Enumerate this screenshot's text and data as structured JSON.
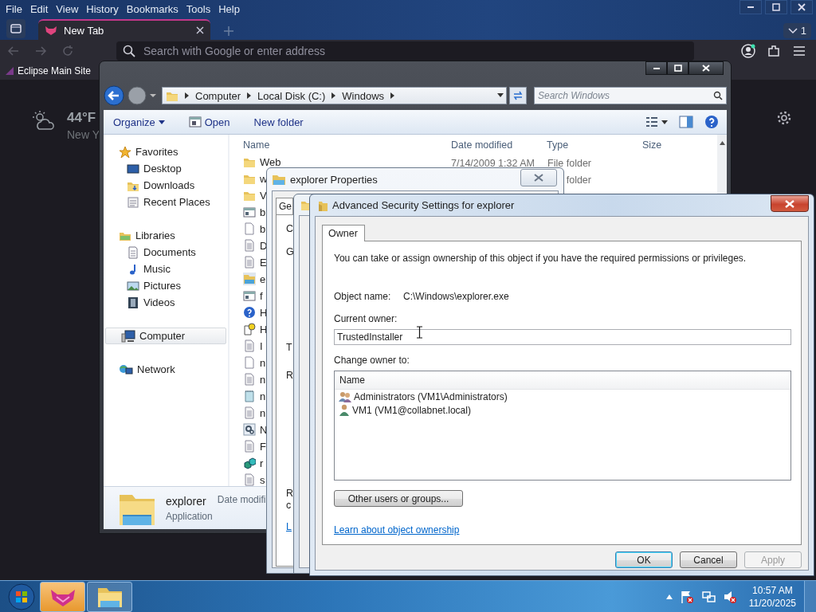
{
  "browser": {
    "menu": [
      "File",
      "Edit",
      "View",
      "History",
      "Bookmarks",
      "Tools",
      "Help"
    ],
    "tabs": [
      {
        "label": "New Tab",
        "selected": true
      }
    ],
    "tab_count": "1",
    "address": {
      "placeholder": "Search with Google or enter address"
    },
    "bookmarks": [
      "Eclipse Main Site"
    ],
    "weather": {
      "temperature": "44°F",
      "location": "New Y"
    }
  },
  "explorer": {
    "breadcrumb": [
      "Computer",
      "Local Disk (C:)",
      "Windows"
    ],
    "search": {
      "placeholder": "Search Windows"
    },
    "toolbar": [
      {
        "label": "Organize",
        "kind": "menu"
      },
      {
        "label": "Open",
        "kind": "open"
      },
      {
        "label": "New folder",
        "kind": "plain"
      }
    ],
    "sidebar": [
      {
        "label": "Favorites",
        "kind": "star",
        "selected": false,
        "children": [
          {
            "label": "Desktop",
            "kind": "desktop",
            "selected": false
          },
          {
            "label": "Downloads",
            "kind": "downloads",
            "selected": false
          },
          {
            "label": "Recent Places",
            "kind": "recent",
            "selected": false
          }
        ]
      },
      {
        "label": "Libraries",
        "kind": "libraries",
        "selected": false,
        "children": [
          {
            "label": "Documents",
            "kind": "documents",
            "selected": false
          },
          {
            "label": "Music",
            "kind": "music",
            "selected": false
          },
          {
            "label": "Pictures",
            "kind": "pictures",
            "selected": false
          },
          {
            "label": "Videos",
            "kind": "videos",
            "selected": false
          }
        ]
      },
      {
        "label": "Computer",
        "kind": "computer",
        "selected": true
      },
      {
        "label": "Network",
        "kind": "network",
        "selected": false
      }
    ],
    "columns": [
      "Name",
      "Date modified",
      "Type",
      "Size"
    ],
    "rows": [
      {
        "name": "Web",
        "date": "7/14/2009 1:32 AM",
        "type": "File folder",
        "kind": "folder"
      },
      {
        "name": "w",
        "type": "folder",
        "kind": "folder"
      },
      {
        "name": "V",
        "kind": "folder"
      },
      {
        "name": "b",
        "kind": "window"
      },
      {
        "name": "b",
        "kind": "page"
      },
      {
        "name": "D",
        "kind": "text"
      },
      {
        "name": "E",
        "kind": "text"
      },
      {
        "name": "e",
        "kind": "explorer"
      },
      {
        "name": "f",
        "kind": "window"
      },
      {
        "name": "H",
        "kind": "help"
      },
      {
        "name": "H",
        "kind": "wizard"
      },
      {
        "name": "I",
        "kind": "text"
      },
      {
        "name": "n",
        "kind": "page"
      },
      {
        "name": "n",
        "kind": "text"
      },
      {
        "name": "n",
        "kind": "notepad"
      },
      {
        "name": "n",
        "kind": "text"
      },
      {
        "name": "N",
        "kind": "gear"
      },
      {
        "name": "F",
        "kind": "text"
      },
      {
        "name": "r",
        "kind": "cubes"
      },
      {
        "name": "s",
        "kind": "text"
      }
    ],
    "details": {
      "name": "explorer",
      "type": "Application",
      "label": "Date modifi"
    }
  },
  "properties": {
    "title": "explorer Properties",
    "tabs": [
      {
        "label": "Ge",
        "selected": true
      }
    ],
    "fragments": [
      {
        "text": "C",
        "kind": "text"
      },
      {
        "text": "G",
        "kind": "text"
      },
      {
        "text": "T",
        "kind": "text"
      },
      {
        "text": "R",
        "kind": "text"
      },
      {
        "text": "R",
        "kind": "text"
      },
      {
        "text": "c",
        "kind": "text"
      },
      {
        "text": "L",
        "kind": "link"
      }
    ]
  },
  "advanced": {
    "title": "Advanced Security Settings for explorer",
    "tabs": [
      {
        "label": "Owner",
        "selected": true
      }
    ],
    "description": "You can take or assign ownership of this object if you have the required permissions or privileges.",
    "object_name": {
      "label": "Object name:",
      "value": "C:\\Windows\\explorer.exe"
    },
    "current_owner": {
      "label": "Current owner:",
      "value": "TrustedInstaller"
    },
    "change_owner": {
      "label": "Change owner to:",
      "columns": [
        "Name"
      ],
      "rows": [
        {
          "name": "Administrators (VM1\\Administrators)",
          "kind": "group"
        },
        {
          "name": "VM1 (VM1@collabnet.local)",
          "kind": "user"
        }
      ]
    },
    "other_button": "Other users or groups...",
    "link": "Learn about object ownership",
    "buttons": [
      {
        "label": "OK",
        "kind": "default",
        "disabled": false
      },
      {
        "label": "Cancel",
        "kind": "normal",
        "disabled": false
      },
      {
        "label": "Apply",
        "kind": "normal",
        "disabled": true
      }
    ]
  },
  "taskbar": {
    "time": "10:57 AM",
    "date": "11/20/2025"
  }
}
